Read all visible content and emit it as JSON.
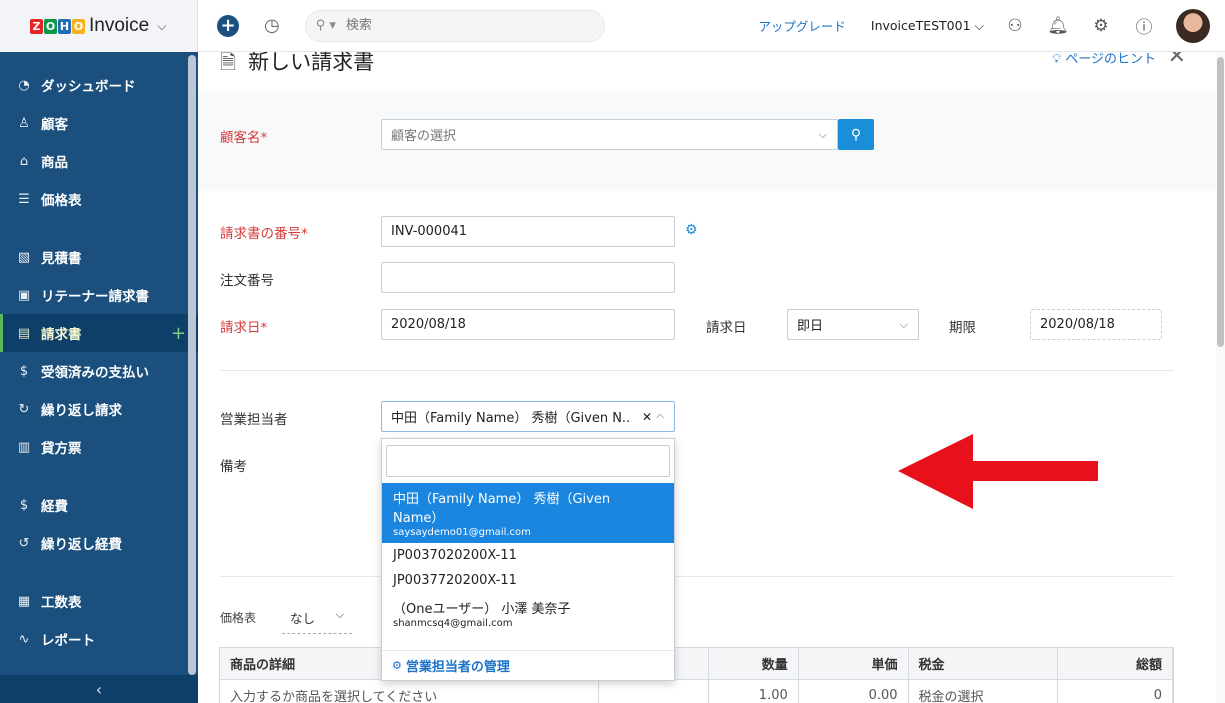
{
  "brand": {
    "logo_letters": [
      "Z",
      "O",
      "H",
      "O"
    ],
    "logo_colors": [
      "#e42527",
      "#089949",
      "#226db4",
      "#f9b21d"
    ],
    "app_name": "Invoice"
  },
  "sidebar": {
    "items": [
      {
        "label": "ダッシュボード",
        "icon": "dashboard-icon",
        "glyph": "◔"
      },
      {
        "label": "顧客",
        "icon": "user-icon",
        "glyph": "♙"
      },
      {
        "label": "商品",
        "icon": "basket-icon",
        "glyph": "⌂"
      },
      {
        "label": "価格表",
        "icon": "list-icon",
        "glyph": "☰"
      },
      {
        "label": "見積書",
        "icon": "estimate-icon",
        "glyph": "▧"
      },
      {
        "label": "リテーナー請求書",
        "icon": "retainer-icon",
        "glyph": "▣"
      },
      {
        "label": "請求書",
        "icon": "invoice-icon",
        "glyph": "▤",
        "active": true
      },
      {
        "label": "受領済みの支払い",
        "icon": "payment-icon",
        "glyph": "$"
      },
      {
        "label": "繰り返し請求",
        "icon": "recurring-invoice-icon",
        "glyph": "↻"
      },
      {
        "label": "貸方票",
        "icon": "credit-note-icon",
        "glyph": "▥"
      },
      {
        "label": "経費",
        "icon": "expense-icon",
        "glyph": "$"
      },
      {
        "label": "繰り返し経費",
        "icon": "recurring-expense-icon",
        "glyph": "↺"
      },
      {
        "label": "工数表",
        "icon": "timesheet-icon",
        "glyph": "▦"
      },
      {
        "label": "レポート",
        "icon": "report-icon",
        "glyph": "∿"
      }
    ],
    "collapse_glyph": "‹"
  },
  "topbar": {
    "search_placeholder": "検索",
    "upgrade": "アップグレード",
    "org": "InvoiceTEST001"
  },
  "page": {
    "title": "新しい請求書",
    "hint": "ページのヒント"
  },
  "form": {
    "customer_label": "顧客名*",
    "customer_placeholder": "顧客の選択",
    "invoice_no_label": "請求書の番号*",
    "invoice_no_value": "INV-000041",
    "order_no_label": "注文番号",
    "order_no_value": "",
    "invoice_date_label": "請求日*",
    "invoice_date_value": "2020/08/18",
    "terms_label": "請求日",
    "terms_value": "即日",
    "due_label": "期限",
    "due_value": "2020/08/18",
    "salesperson_label": "営業担当者",
    "salesperson_value": "中田（Family Name） 秀樹（Given N...",
    "notes_label": "備考"
  },
  "dropdown": {
    "items": [
      {
        "name": "中田（Family Name） 秀樹（Given Name）",
        "email": "saysaydemo01@gmail.com",
        "selected": true
      },
      {
        "name": "JP0037020200X-11",
        "email": ""
      },
      {
        "name": "JP0037720200X-11",
        "email": ""
      },
      {
        "name": "（Oneユーザー） 小澤 美奈子",
        "email": "shanmcsq4@gmail.com"
      }
    ],
    "footer": "営業担当者の管理"
  },
  "pricelist": {
    "label": "価格表",
    "value": "なし"
  },
  "table": {
    "headers": [
      "商品の詳細",
      "",
      "数量",
      "単価",
      "税金",
      "総額"
    ],
    "row": [
      "入力するか商品を選択してください",
      "",
      "1.00",
      "0.00",
      "税金の選択",
      "0"
    ]
  },
  "colors": {
    "sidebar": "#1a4f7e",
    "accent": "#1a86df",
    "required": "#d43b3b",
    "arrow": "#e8101a"
  }
}
